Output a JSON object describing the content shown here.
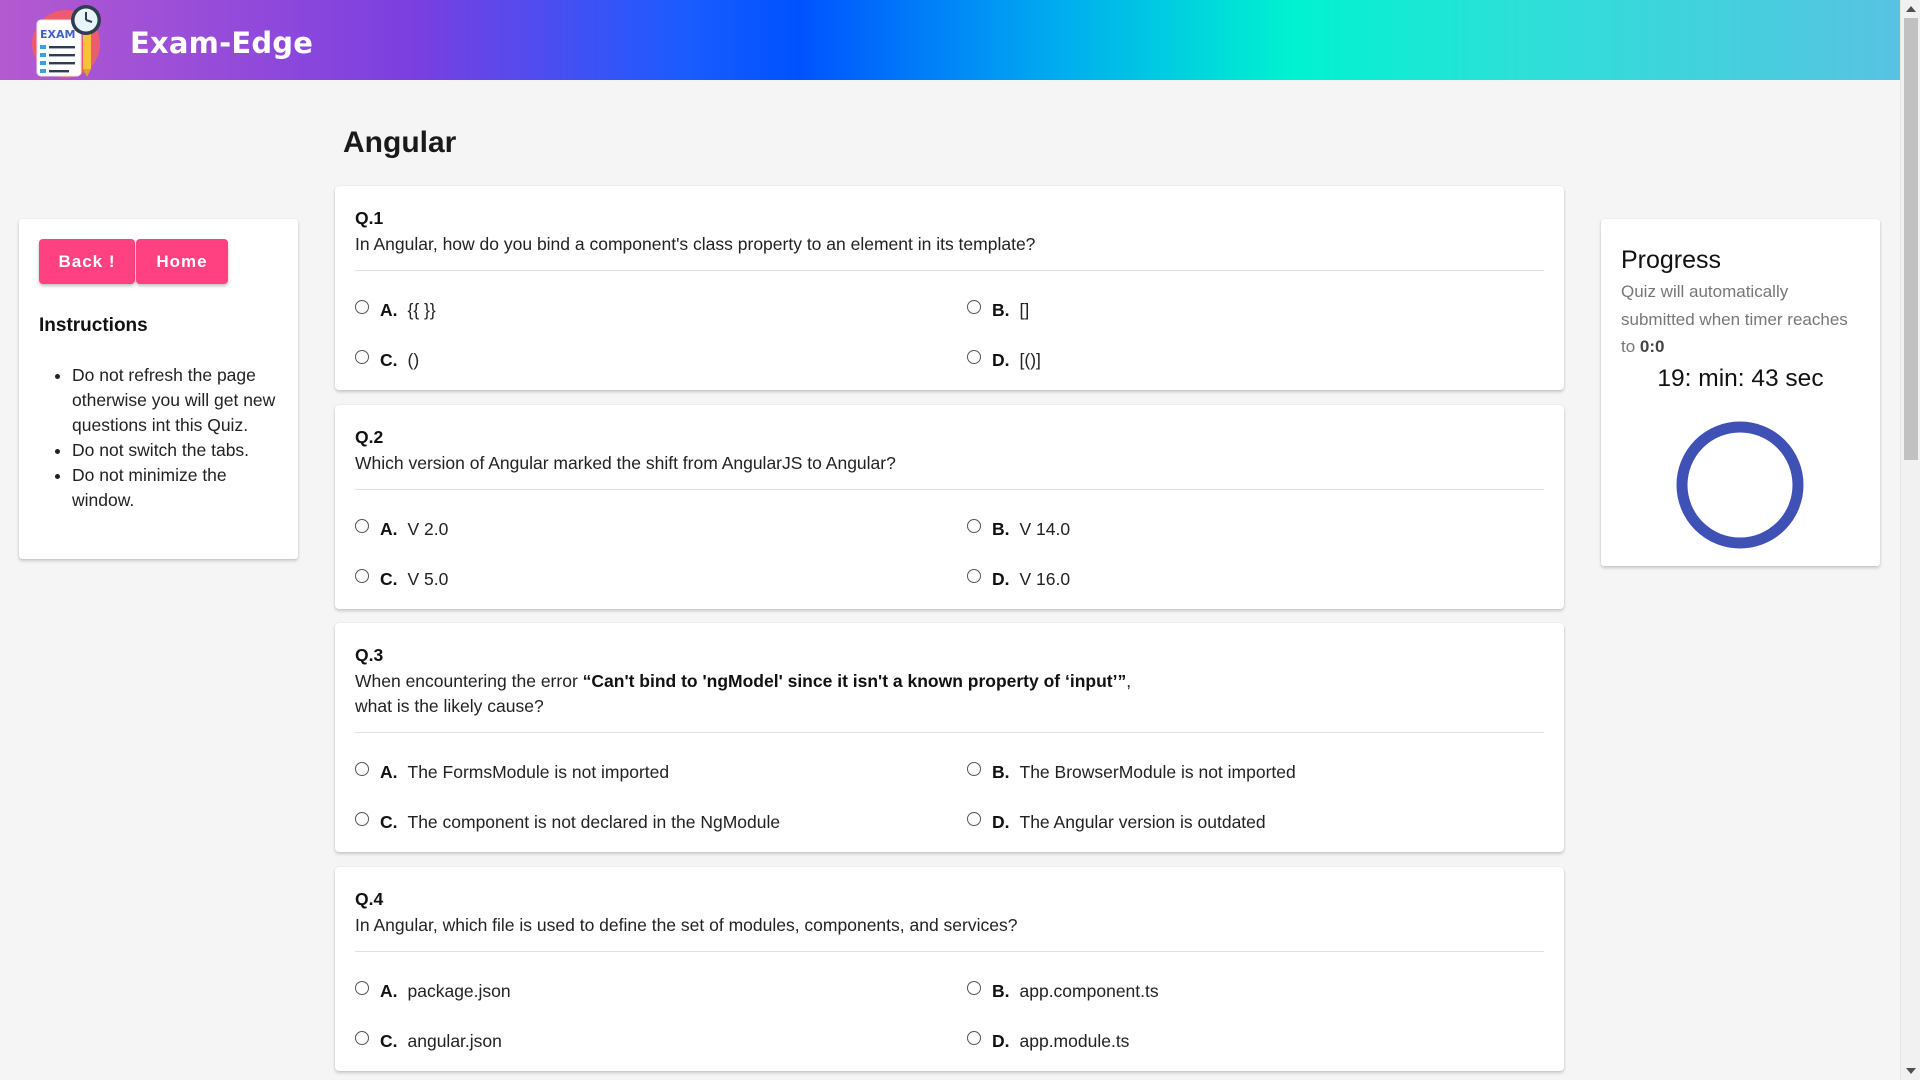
{
  "header": {
    "brand": "Exam-Edge",
    "logo_label": "EXAM",
    "gradient_colors": [
      "#b45ad0",
      "#0052ff",
      "#00f2d0",
      "#58c2e2"
    ]
  },
  "sidebar": {
    "back_label": "Back !",
    "home_label": "Home",
    "button_color": "#ff4081",
    "instructions_title": "Instructions",
    "instructions": [
      "Do not refresh the page otherwise you will get new questions int this Quiz.",
      "Do not switch the tabs.",
      "Do not minimize the window."
    ]
  },
  "main": {
    "title": "Angular",
    "questions": [
      {
        "number": "Q.1",
        "text_before": "In Angular, how do you bind a component's class property to an element in its template?",
        "text_bold": "",
        "text_after": "",
        "options": [
          {
            "letter": "A.",
            "text": "{{ }}"
          },
          {
            "letter": "B.",
            "text": "[]"
          },
          {
            "letter": "C.",
            "text": "()"
          },
          {
            "letter": "D.",
            "text": "[()]"
          }
        ]
      },
      {
        "number": "Q.2",
        "text_before": "Which version of Angular marked the shift from AngularJS to Angular?",
        "text_bold": "",
        "text_after": "",
        "options": [
          {
            "letter": "A.",
            "text": "V 2.0"
          },
          {
            "letter": "B.",
            "text": "V 14.0"
          },
          {
            "letter": "C.",
            "text": "V 5.0"
          },
          {
            "letter": "D.",
            "text": "V 16.0"
          }
        ]
      },
      {
        "number": "Q.3",
        "text_before": "When encountering the error ",
        "text_bold": "“Can't bind to 'ngModel' since it isn't a known property of ‘input’”",
        "text_after": ",",
        "text_line2": "what is the likely cause?",
        "options": [
          {
            "letter": "A.",
            "text": "The FormsModule is not imported"
          },
          {
            "letter": "B.",
            "text": "The BrowserModule is not imported"
          },
          {
            "letter": "C.",
            "text": "The component is not declared in the NgModule"
          },
          {
            "letter": "D.",
            "text": "The Angular version is outdated"
          }
        ]
      },
      {
        "number": "Q.4",
        "text_before": "In Angular, which file is used to define the set of modules, components, and services?",
        "text_bold": "",
        "text_after": "",
        "options": [
          {
            "letter": "A.",
            "text": "package.json"
          },
          {
            "letter": "B.",
            "text": "app.component.ts"
          },
          {
            "letter": "C.",
            "text": "angular.json"
          },
          {
            "letter": "D.",
            "text": "app.module.ts"
          }
        ]
      }
    ]
  },
  "progress": {
    "title": "Progress",
    "desc_text": "Quiz will automatically submitted when timer reaches to ",
    "desc_bold": "0:0",
    "timer": "19: min: 43 sec",
    "ring_color": "#3f51b5",
    "ring_fraction": 1.0
  }
}
